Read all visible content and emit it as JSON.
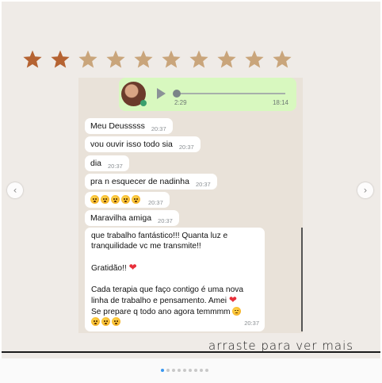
{
  "rating": {
    "filled": 2,
    "total": 10,
    "filled_color": "#b56332",
    "empty_color": "#c9a57b"
  },
  "voice_message": {
    "duration": "2:29",
    "time": "18:14"
  },
  "messages": [
    {
      "text": "Meu Deusssss",
      "time": "20:37"
    },
    {
      "text": "vou ouvir isso todo sia",
      "time": "20:37"
    },
    {
      "text": "dia",
      "time": "20:37"
    },
    {
      "text": "pra n esquecer de nadinha",
      "time": "20:37"
    },
    {
      "emojis": 5,
      "time": "20:37"
    },
    {
      "text": "Maravilha amiga",
      "time": "20:37"
    }
  ],
  "long_message": {
    "line1": "que trabalho fantástico!!! Quanta luz e",
    "line2": "tranquilidade vc me transmite!!",
    "line3": "Gratidão!!",
    "line4": "Cada terapia que faço contigo é uma nova",
    "line5": "linha de trabalho e pensamento. Amei",
    "line6": "Se prepare q todo ano agora temmmm",
    "time": "20:37"
  },
  "hint": "arraste para ver mais",
  "carousel": {
    "total_dots": 9,
    "active_index": 0
  },
  "nav": {
    "prev": "‹",
    "next": "›"
  }
}
